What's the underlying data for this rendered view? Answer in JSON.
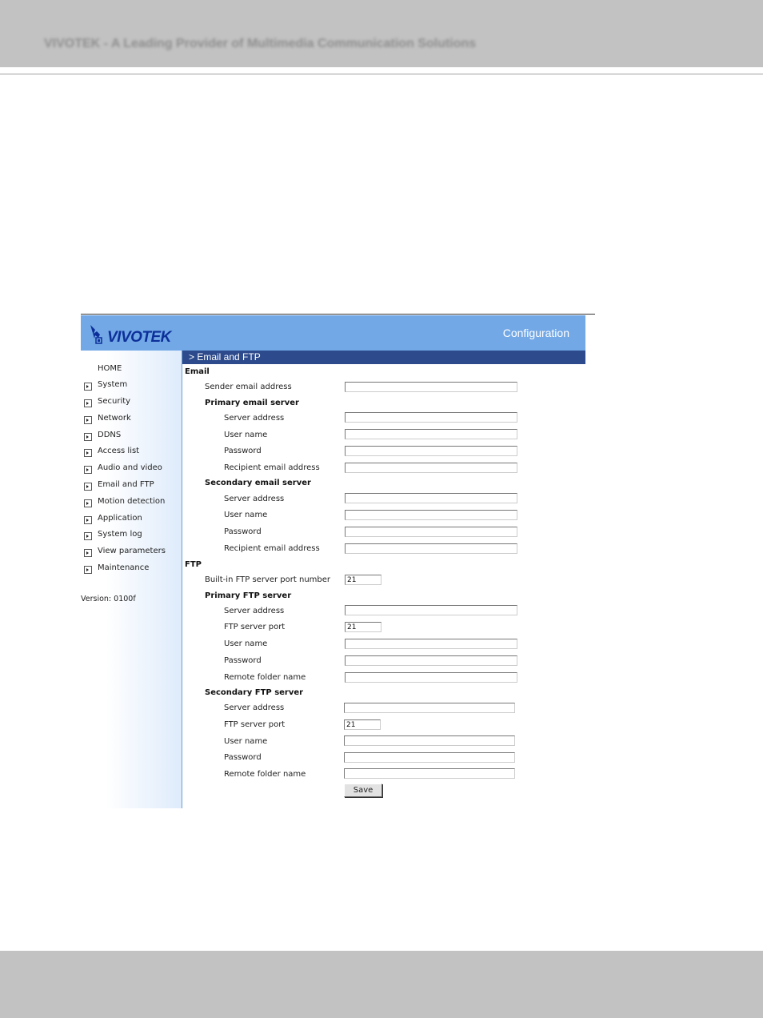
{
  "document": {
    "header_text": "VIVOTEK - A Leading Provider of Multimedia Communication Solutions"
  },
  "app": {
    "logo_text": "VIVOTEK",
    "banner_title": "Configuration",
    "section_title": "> Email and FTP",
    "version": "Version: 0100f"
  },
  "sidebar": {
    "home": "HOME",
    "items": [
      {
        "label": "System"
      },
      {
        "label": "Security"
      },
      {
        "label": "Network"
      },
      {
        "label": "DDNS"
      },
      {
        "label": "Access list"
      },
      {
        "label": "Audio and video"
      },
      {
        "label": "Email and FTP"
      },
      {
        "label": "Motion detection"
      },
      {
        "label": "Application"
      },
      {
        "label": "System log"
      },
      {
        "label": "View parameters"
      },
      {
        "label": "Maintenance"
      }
    ]
  },
  "email": {
    "title": "Email",
    "sender_label": "Sender email address",
    "sender_value": "",
    "primary": {
      "title": "Primary email server",
      "server_label": "Server address",
      "server_value": "",
      "user_label": "User name",
      "user_value": "",
      "pass_label": "Password",
      "pass_value": "",
      "recipient_label": "Recipient email address",
      "recipient_value": ""
    },
    "secondary": {
      "title": "Secondary email server",
      "server_label": "Server address",
      "server_value": "",
      "user_label": "User name",
      "user_value": "",
      "pass_label": "Password",
      "pass_value": "",
      "recipient_label": "Recipient email address",
      "recipient_value": ""
    }
  },
  "ftp": {
    "title": "FTP",
    "builtin_label": "Built-in FTP server port number",
    "builtin_value": "21",
    "primary": {
      "title": "Primary FTP server",
      "server_label": "Server address",
      "server_value": "",
      "port_label": "FTP server port",
      "port_value": "21",
      "user_label": "User name",
      "user_value": "",
      "pass_label": "Password",
      "pass_value": "",
      "folder_label": "Remote folder name",
      "folder_value": ""
    },
    "secondary": {
      "title": "Secondary FTP server",
      "server_label": "Server address",
      "server_value": "",
      "port_label": "FTP server port",
      "port_value": "21",
      "user_label": "User name",
      "user_value": "",
      "pass_label": "Password",
      "pass_value": "",
      "folder_label": "Remote folder name",
      "folder_value": ""
    }
  },
  "actions": {
    "save_label": "Save"
  },
  "colors": {
    "banner": "#72a8e6",
    "section_bar": "#2c4a8c",
    "logo": "#0c2f99"
  }
}
